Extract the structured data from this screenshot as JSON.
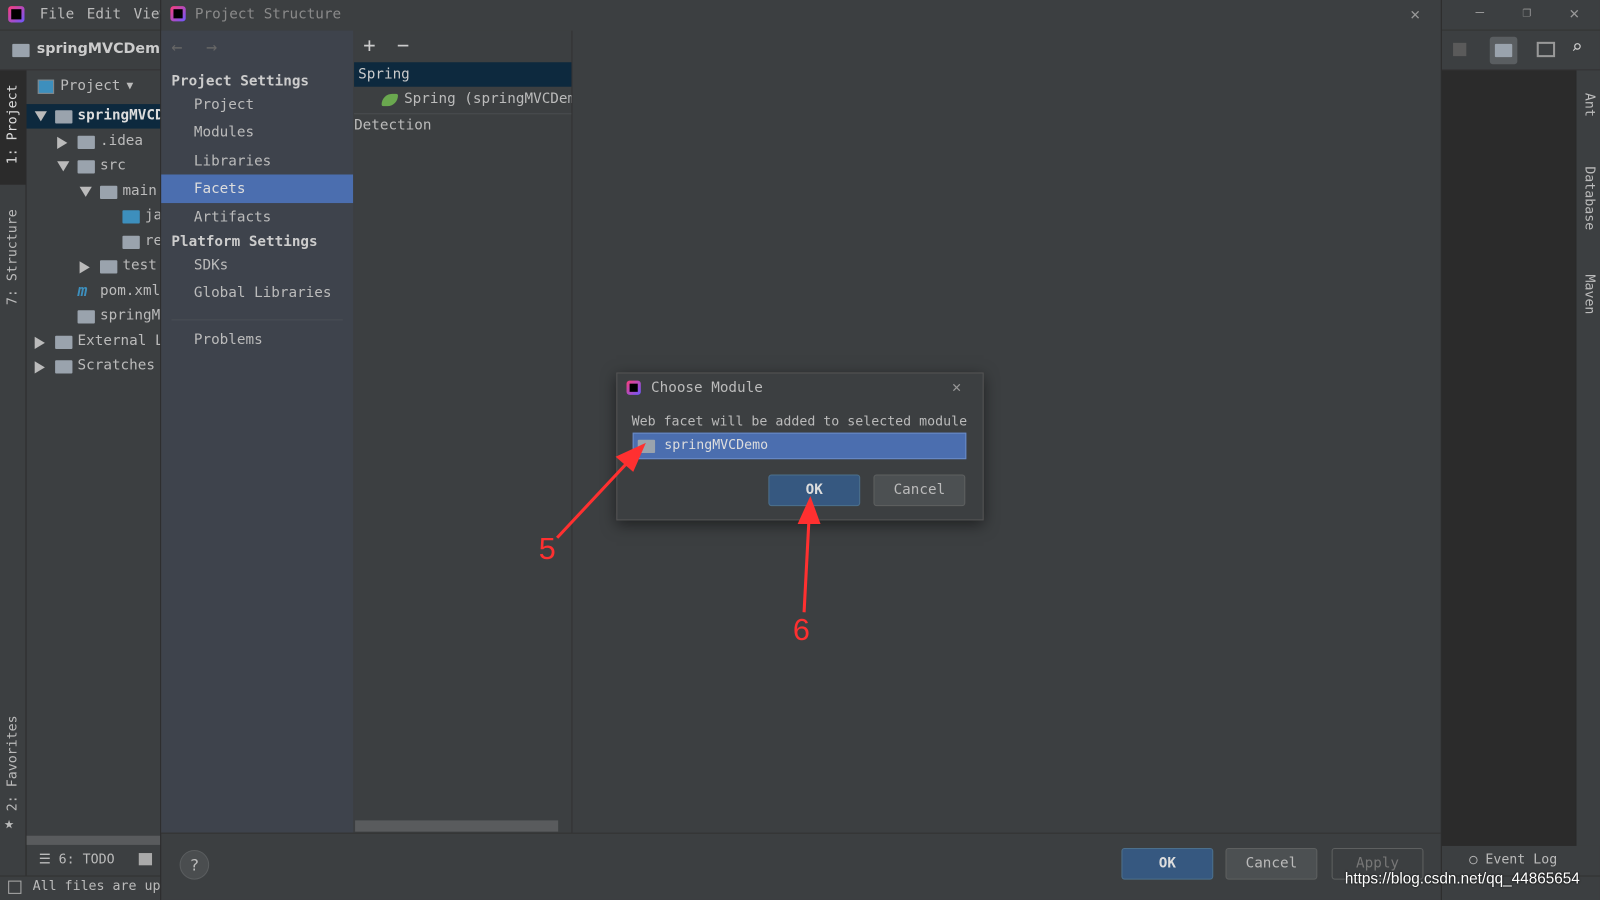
{
  "ide": {
    "menu": [
      "File",
      "Edit",
      "View"
    ],
    "project_name": "springMVCDemo",
    "project_view_label": "Project",
    "tree": [
      {
        "label": "springMVCDemo",
        "level": 0,
        "expanded": true,
        "selected": true,
        "icon": "module-folder-icon"
      },
      {
        "label": ".idea",
        "level": 1,
        "expanded": false,
        "icon": "folder-icon"
      },
      {
        "label": "src",
        "level": 1,
        "expanded": true,
        "icon": "folder-icon"
      },
      {
        "label": "main",
        "level": 2,
        "expanded": true,
        "icon": "folder-icon"
      },
      {
        "label": "ja",
        "level": 3,
        "icon": "source-folder-icon"
      },
      {
        "label": "re",
        "level": 3,
        "icon": "resources-folder-icon"
      },
      {
        "label": "test",
        "level": 2,
        "expanded": false,
        "icon": "folder-icon"
      },
      {
        "label": "pom.xml",
        "level": 1,
        "icon": "maven-icon"
      },
      {
        "label": "springM\\",
        "level": 1,
        "icon": "iml-file-icon"
      },
      {
        "label": "External Li",
        "level": 0,
        "expanded": false,
        "icon": "libraries-icon"
      },
      {
        "label": "Scratches a",
        "level": 0,
        "expanded": false,
        "icon": "scratches-icon"
      }
    ],
    "left_tool_windows": [
      "1: Project",
      "7: Structure",
      "2: Favorites"
    ],
    "right_tool_windows": [
      "Ant",
      "Database",
      "Maven"
    ],
    "bottom_tools": [
      "6: TODO"
    ],
    "status_text": "All files are up",
    "event_log": "Event Log"
  },
  "dialog": {
    "title": "Project Structure",
    "project_settings_header": "Project Settings",
    "project_settings": [
      "Project",
      "Modules",
      "Libraries",
      "Facets",
      "Artifacts"
    ],
    "selected": "Facets",
    "platform_settings_header": "Platform Settings",
    "platform_settings": [
      "SDKs",
      "Global Libraries"
    ],
    "problems": "Problems",
    "facet_group": "Spring",
    "facet_item": "Spring (springMVCDemo",
    "detection": "Detection",
    "ok": "OK",
    "cancel": "Cancel",
    "apply": "Apply"
  },
  "choose_module": {
    "title": "Choose Module",
    "message": "Web facet will be added to selected module",
    "module": "springMVCDemo",
    "ok": "OK",
    "cancel": "Cancel"
  },
  "annotations": {
    "step5": "5",
    "step6": "6",
    "color": "#ff3030"
  },
  "watermark": "https://blog.csdn.net/qq_44865654"
}
